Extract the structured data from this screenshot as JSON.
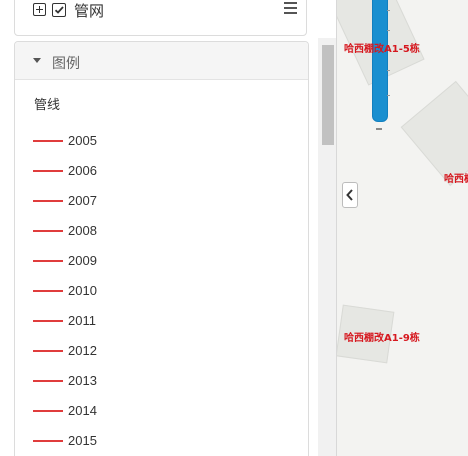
{
  "layers": {
    "network_label": "管网"
  },
  "legend": {
    "title": "图例",
    "group_title": "管线",
    "line_color": "#e03c3c",
    "items": [
      {
        "label": "2005"
      },
      {
        "label": "2006"
      },
      {
        "label": "2007"
      },
      {
        "label": "2008"
      },
      {
        "label": "2009"
      },
      {
        "label": "2010"
      },
      {
        "label": "2011"
      },
      {
        "label": "2012"
      },
      {
        "label": "2013"
      },
      {
        "label": "2014"
      },
      {
        "label": "2015"
      }
    ]
  },
  "map": {
    "labels": {
      "building_a1_5": "哈西棚改A1-5栋",
      "building_partial": "哈西棚",
      "building_a1_9": "哈西棚改A1-9栋"
    },
    "label_color": "#d6181f",
    "zoom_color": "#1a8fd0"
  }
}
